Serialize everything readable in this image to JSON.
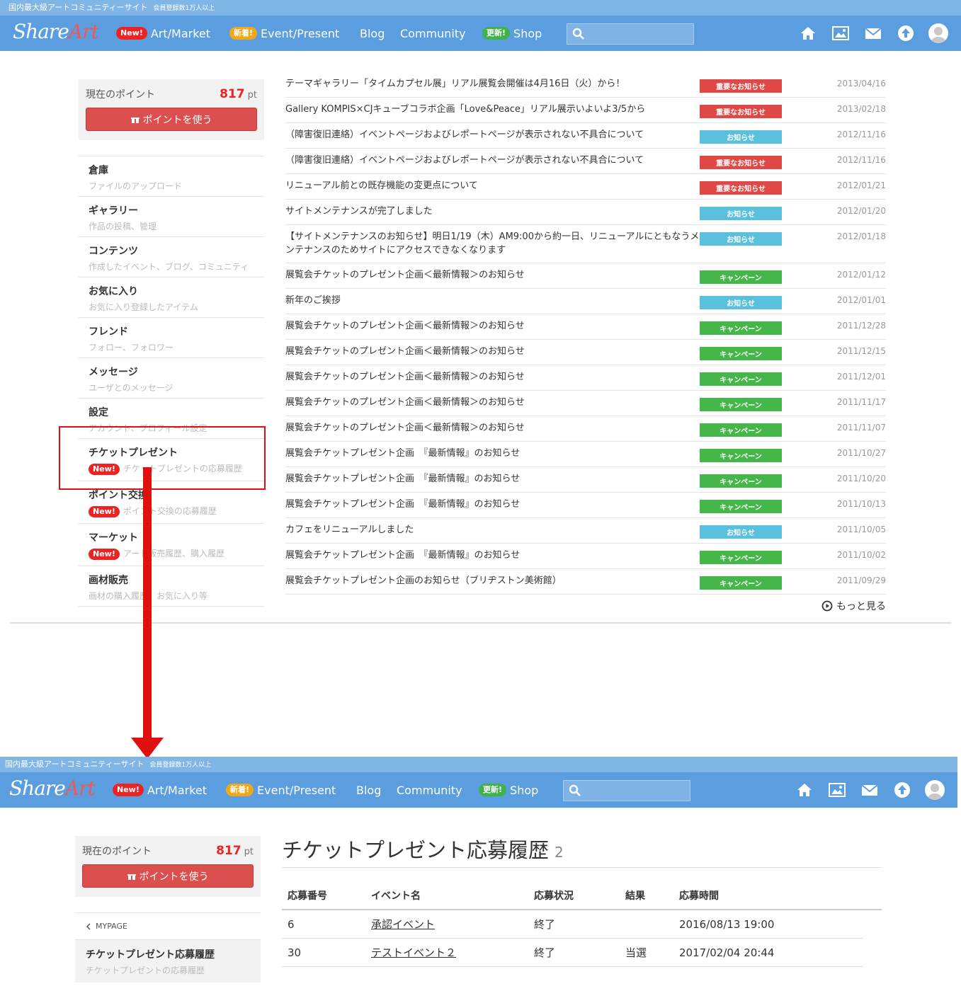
{
  "header": {
    "tagline": "国内最大級アートコミュニティーサイト",
    "members": "会員登録数1万人以上",
    "logo_share": "Share",
    "logo_art": "Art",
    "nav": [
      {
        "badge": "New!",
        "label": "Art/Market"
      },
      {
        "badge": "新着!",
        "label": "Event/Present"
      },
      {
        "badge": "",
        "label": "Blog"
      },
      {
        "badge": "",
        "label": "Community"
      },
      {
        "badge": "更新!",
        "label": "Shop"
      }
    ],
    "search_placeholder": "",
    "icons": [
      "home-icon",
      "gallery-icon",
      "mail-icon",
      "upload-icon",
      "avatar-icon"
    ]
  },
  "points": {
    "label": "現在のポイント",
    "value": "817",
    "unit": "pt",
    "button": "ポイントを使う"
  },
  "sidebar": {
    "items": [
      {
        "title": "倉庫",
        "sub": "ファイルのアップロード"
      },
      {
        "title": "ギャラリー",
        "sub": "作品の投稿、管理"
      },
      {
        "title": "コンテンツ",
        "sub": "作成したイベント、ブログ、コミュニティ"
      },
      {
        "title": "お気に入り",
        "sub": "お気に入り登録したアイテム"
      },
      {
        "title": "フレンド",
        "sub": "フォロー、フォロワー"
      },
      {
        "title": "メッセージ",
        "sub": "ユーザとのメッセージ"
      },
      {
        "title": "設定",
        "sub": "アカウント、プロフィール設定"
      },
      {
        "title": "チケットプレゼント",
        "sub": "チケットプレゼントの応募履歴",
        "badge": "New!"
      },
      {
        "title": "ポイント交換",
        "sub": "ポイント交換の応募履歴",
        "badge": "New!"
      },
      {
        "title": "マーケット",
        "sub": "アート販売履歴、購入履歴",
        "badge": "New!"
      },
      {
        "title": "画材販売",
        "sub": "画材の購入履歴、お気に入り等"
      }
    ]
  },
  "news": {
    "items": [
      {
        "title": "テーマギャラリー「タイムカプセル展」リアル展覧会開催は4月16日（火）から！",
        "tag": "重要なお知らせ",
        "color": "#e04848",
        "date": "2013/04/16"
      },
      {
        "title": "Gallery KOMPIS×CJキューブコラボ企画「Love&Peace」リアル展示いよいよ3/5から",
        "tag": "重要なお知らせ",
        "color": "#e04848",
        "date": "2013/02/18"
      },
      {
        "title": "（障害復旧連絡）イベントページおよびレポートページが表示されない不具合について",
        "tag": "お知らせ",
        "color": "#5bc0de",
        "date": "2012/11/16"
      },
      {
        "title": "（障害復旧連絡）イベントページおよびレポートページが表示されない不具合について",
        "tag": "重要なお知らせ",
        "color": "#e04848",
        "date": "2012/11/16"
      },
      {
        "title": "リニューアル前との既存機能の変更点について",
        "tag": "重要なお知らせ",
        "color": "#e04848",
        "date": "2012/01/21"
      },
      {
        "title": "サイトメンテナンスが完了しました",
        "tag": "お知らせ",
        "color": "#5bc0de",
        "date": "2012/01/20"
      },
      {
        "title": "【サイトメンテナンスのお知らせ】明日1/19（木）AM9:00から約一日、リニューアルにともなうメンテナンスのためサイトにアクセスできなくなります",
        "tag": "お知らせ",
        "color": "#5bc0de",
        "date": "2012/01/18",
        "two": true
      },
      {
        "title": "展覧会チケットのプレゼント企画＜最新情報＞のお知らせ",
        "tag": "キャンペーン",
        "color": "#45b649",
        "date": "2012/01/12"
      },
      {
        "title": "新年のご挨拶",
        "tag": "お知らせ",
        "color": "#5bc0de",
        "date": "2012/01/01"
      },
      {
        "title": "展覧会チケットのプレゼント企画＜最新情報＞のお知らせ",
        "tag": "キャンペーン",
        "color": "#45b649",
        "date": "2011/12/28"
      },
      {
        "title": "展覧会チケットのプレゼント企画＜最新情報＞のお知らせ",
        "tag": "キャンペーン",
        "color": "#45b649",
        "date": "2011/12/15"
      },
      {
        "title": "展覧会チケットのプレゼント企画＜最新情報＞のお知らせ",
        "tag": "キャンペーン",
        "color": "#45b649",
        "date": "2011/12/01"
      },
      {
        "title": "展覧会チケットのプレゼント企画＜最新情報＞のお知らせ",
        "tag": "キャンペーン",
        "color": "#45b649",
        "date": "2011/11/17"
      },
      {
        "title": "展覧会チケットのプレゼント企画＜最新情報＞のお知らせ",
        "tag": "キャンペーン",
        "color": "#45b649",
        "date": "2011/11/07"
      },
      {
        "title": "展覧会チケットプレゼント企画　『最新情報』のお知らせ",
        "tag": "キャンペーン",
        "color": "#45b649",
        "date": "2011/10/27"
      },
      {
        "title": "展覧会チケットプレゼント企画　『最新情報』のお知らせ",
        "tag": "キャンペーン",
        "color": "#45b649",
        "date": "2011/10/20"
      },
      {
        "title": "展覧会チケットプレゼント企画　『最新情報』のお知らせ",
        "tag": "キャンペーン",
        "color": "#45b649",
        "date": "2011/10/13"
      },
      {
        "title": "カフェをリニューアルしました",
        "tag": "お知らせ",
        "color": "#5bc0de",
        "date": "2011/10/05"
      },
      {
        "title": "展覧会チケットプレゼント企画　『最新情報』のお知らせ",
        "tag": "キャンペーン",
        "color": "#45b649",
        "date": "2011/10/02"
      },
      {
        "title": "展覧会チケットプレゼント企画のお知らせ（ブリヂストン美術館）",
        "tag": "キャンペーン",
        "color": "#45b649",
        "date": "2011/09/29"
      }
    ],
    "more": "もっと見る"
  },
  "sub": {
    "back": "MYPAGE",
    "current_title": "チケットプレゼント応募履歴",
    "current_sub": "チケットプレゼントの応募履歴",
    "heading": "チケットプレゼント応募履歴",
    "count": "2",
    "columns": [
      "応募番号",
      "イベント名",
      "応募状況",
      "結果",
      "応募時間"
    ],
    "rows": [
      [
        "6",
        "承認イベント",
        "終了",
        "",
        "2016/08/13 19:00"
      ],
      [
        "30",
        "テストイベント２",
        "終了",
        "当選",
        "2017/02/04 20:44"
      ]
    ]
  }
}
